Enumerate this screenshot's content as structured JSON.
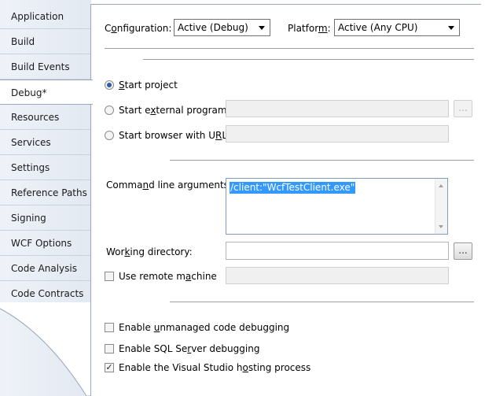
{
  "tabs": [
    {
      "label": "Application"
    },
    {
      "label": "Build"
    },
    {
      "label": "Build Events"
    },
    {
      "label": "Debug*"
    },
    {
      "label": "Resources"
    },
    {
      "label": "Services"
    },
    {
      "label": "Settings"
    },
    {
      "label": "Reference Paths"
    },
    {
      "label": "Signing"
    },
    {
      "label": "WCF Options"
    },
    {
      "label": "Code Analysis"
    },
    {
      "label": "Code Contracts"
    }
  ],
  "toolbar": {
    "configuration_label_pre": "C",
    "configuration_label_ul": "o",
    "configuration_label_post": "nfiguration:",
    "configuration_value": "Active (Debug)",
    "platform_label_pre": "Platfor",
    "platform_label_ul": "m",
    "platform_label_post": ":",
    "platform_value": "Active (Any CPU)"
  },
  "start_action": {
    "start_project_ul": "S",
    "start_project_post": "tart project",
    "start_external_pre": "Start e",
    "start_external_ul": "x",
    "start_external_post": "ternal program:",
    "start_browser_pre": "Start browser with U",
    "start_browser_ul": "R",
    "start_browser_post": "L:",
    "browse_button": "..."
  },
  "start_options": {
    "command_args_pre": "Comma",
    "command_args_ul": "n",
    "command_args_post": "d line arguments:",
    "command_args_value": "/client:\"WcfTestClient.exe\"",
    "working_dir_pre": "Wor",
    "working_dir_ul": "k",
    "working_dir_post": "ing directory:",
    "working_dir_button": "...",
    "remote_pre": "Use remote m",
    "remote_ul": "a",
    "remote_post": "chine"
  },
  "debuggers": {
    "unmanaged_pre": "Enable ",
    "unmanaged_ul": "u",
    "unmanaged_post": "nmanaged code debugging",
    "sql_pre": "Enable SQL Se",
    "sql_ul": "r",
    "sql_post": "ver debugging",
    "hosting_pre": "Enable the Visual Studio h",
    "hosting_ul": "o",
    "hosting_post": "sting process",
    "checkmark": "✓"
  }
}
